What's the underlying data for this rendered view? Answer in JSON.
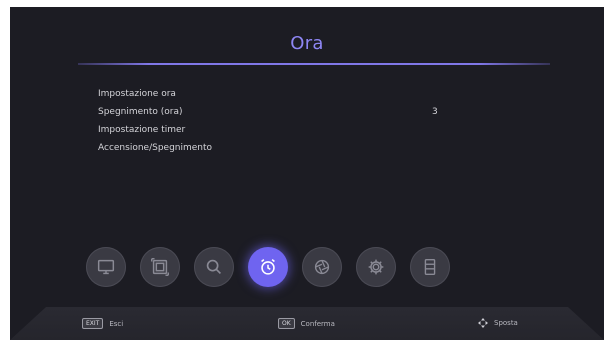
{
  "header": {
    "title": "Ora"
  },
  "menu": {
    "items": [
      {
        "label": "Impostazione ora",
        "value": ""
      },
      {
        "label": "Spegnimento (ora)",
        "value": "3"
      },
      {
        "label": "Impostazione timer",
        "value": ""
      },
      {
        "label": "Accensione/Spegnimento",
        "value": ""
      }
    ]
  },
  "toolbar": {
    "icons": [
      {
        "name": "tv-icon",
        "active": false
      },
      {
        "name": "picture-icon",
        "active": false
      },
      {
        "name": "search-icon",
        "active": false
      },
      {
        "name": "alarm-clock-icon",
        "active": true
      },
      {
        "name": "aperture-icon",
        "active": false
      },
      {
        "name": "gear-icon",
        "active": false
      },
      {
        "name": "storage-icon",
        "active": false
      }
    ]
  },
  "footer": {
    "exit_key": "EXIT",
    "exit_label": "Esci",
    "ok_key": "OK",
    "ok_label": "Conferma",
    "move_label": "Sposta"
  },
  "colors": {
    "accent": "#8e86f4",
    "active_icon": "#6f64f0",
    "background": "#1c1c23"
  }
}
